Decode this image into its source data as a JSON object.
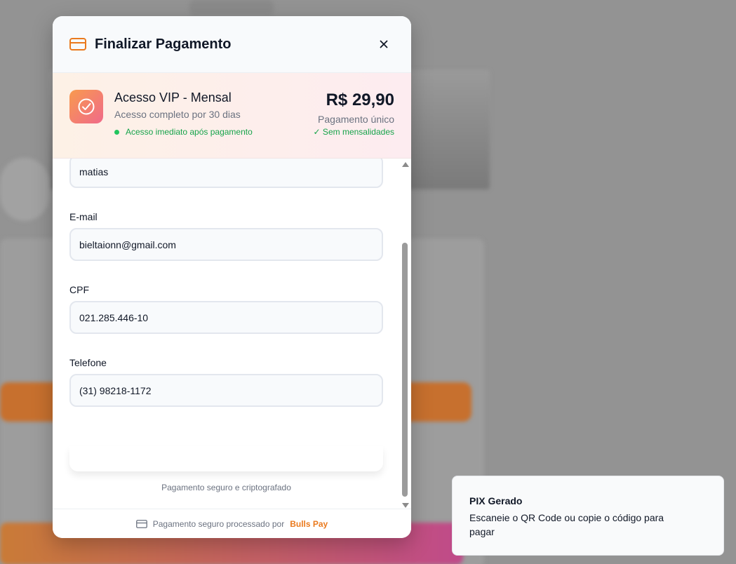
{
  "modal": {
    "title": "Finalizar Pagamento",
    "close_label": "×"
  },
  "product": {
    "name": "Acesso VIP - Mensal",
    "subtitle": "Acesso completo por 30 dias",
    "note": "Acesso imediato após pagamento",
    "price": "R$ 29,90",
    "payment_type": "Pagamento único",
    "no_subscription": "✓ Sem mensalidades"
  },
  "form": {
    "name_value": "matias",
    "email_label": "E-mail",
    "email_value": "bieltaionn@gmail.com",
    "cpf_label": "CPF",
    "cpf_value": "021.285.446-10",
    "phone_label": "Telefone",
    "phone_value": "(31) 98218-1172",
    "secure_text": "Pagamento seguro e criptografado"
  },
  "footer": {
    "text": "Pagamento seguro processado por",
    "brand": "Bulls Pay"
  },
  "toast": {
    "title": "PIX Gerado",
    "description": "Escaneie o QR Code ou copie o código para pagar"
  },
  "colors": {
    "accent": "#ea7a1e",
    "success": "#16a34a"
  }
}
